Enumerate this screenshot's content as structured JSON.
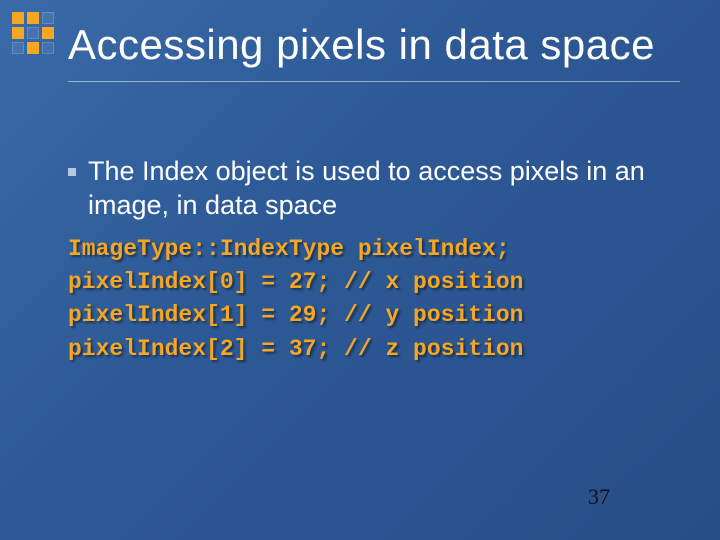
{
  "slide": {
    "title": "Accessing pixels in data space",
    "bullet": "The Index object is used to access pixels in an image, in data space",
    "code_lines": [
      "ImageType::IndexType pixelIndex;",
      "pixelIndex[0] = 27; // x position",
      "pixelIndex[1] = 29; // y position",
      "pixelIndex[2] = 37; // z position"
    ],
    "page_number": "37"
  },
  "corner_pattern": [
    "lit",
    "lit",
    "dim",
    "lit",
    "dim",
    "lit",
    "dim",
    "lit",
    "dim"
  ],
  "colors": {
    "accent": "#f5a623",
    "bg": "#2d5a96",
    "text": "#ffffff"
  }
}
